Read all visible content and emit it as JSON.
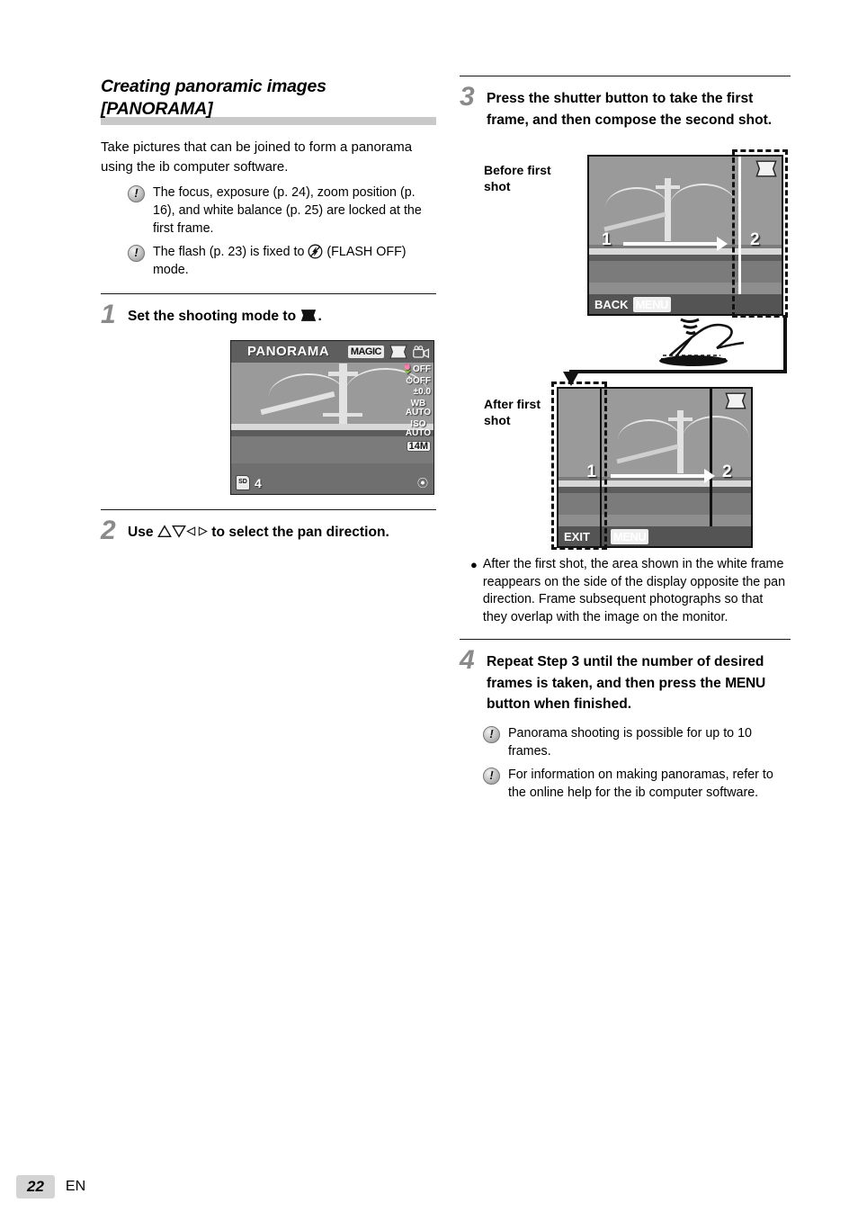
{
  "section": {
    "title_line1": "Creating panoramic images",
    "title_line2": "[PANORAMA]",
    "intro": "Take pictures that can be joined to form a panorama using the ib computer software.",
    "notes": [
      "The focus, exposure (p. 24), zoom position (p. 16), and white balance (p. 25) are locked at the first frame.",
      "The flash (p. 23) is fixed to ④ (FLASH OFF) mode."
    ],
    "note2_part1": "The flash (p. 23) is fixed to ",
    "note2_part2": " (FLASH OFF) mode."
  },
  "steps": {
    "one": {
      "number": "1",
      "text_before": "Set the shooting mode to ",
      "text_after": "."
    },
    "two": {
      "number": "2",
      "text_before": "Use ",
      "text_after": " to select the pan direction."
    },
    "three": {
      "number": "3",
      "text": "Press the shutter button to take the first frame, and then compose the second shot."
    },
    "four": {
      "number": "4",
      "text_part1": "Repeat Step 3 until the number of desired frames is taken, and then press the ",
      "menu_word": "MENU",
      "text_part2": " button when finished."
    }
  },
  "lcd_step1": {
    "mode_label": "PANORAMA",
    "magic_label": "MAGIC",
    "macro": "OFF",
    "selftimer": "OFF",
    "exposure": "±0.0",
    "wb_label": "WB",
    "wb_value": "AUTO",
    "iso_label": "ISO",
    "iso_value": "AUTO",
    "image_size": "14M",
    "card_label": "SD",
    "frames_remaining": "4"
  },
  "diagram": {
    "caption_before": "Before first shot",
    "caption_after": "After first shot",
    "before": {
      "frame1_label": "1",
      "frame2_label": "2",
      "button_label": "BACK",
      "menu_chip": "MENU"
    },
    "after": {
      "frame1_label": "1",
      "frame2_label": "2",
      "button_label": "EXIT",
      "menu_chip": "MENU"
    },
    "shutter_icon": "finger-press-shutter-icon"
  },
  "bullets": [
    "After the first shot, the area shown in the white frame reappears on the side of the display opposite the pan direction. Frame subsequent photographs so that they overlap with the image on the monitor."
  ],
  "step4_notes": [
    "Panorama shooting is possible for up to 10 frames.",
    "For information on making panoramas, refer to the online help for the ib computer software."
  ],
  "footer": {
    "page_number": "22",
    "language": "EN"
  },
  "colors": {
    "grey_rule": "#c9c9c9",
    "step_number": "#8a8a8a",
    "page_badge": "#d4d4d4",
    "lcd_sky": "#9a9a9a"
  }
}
